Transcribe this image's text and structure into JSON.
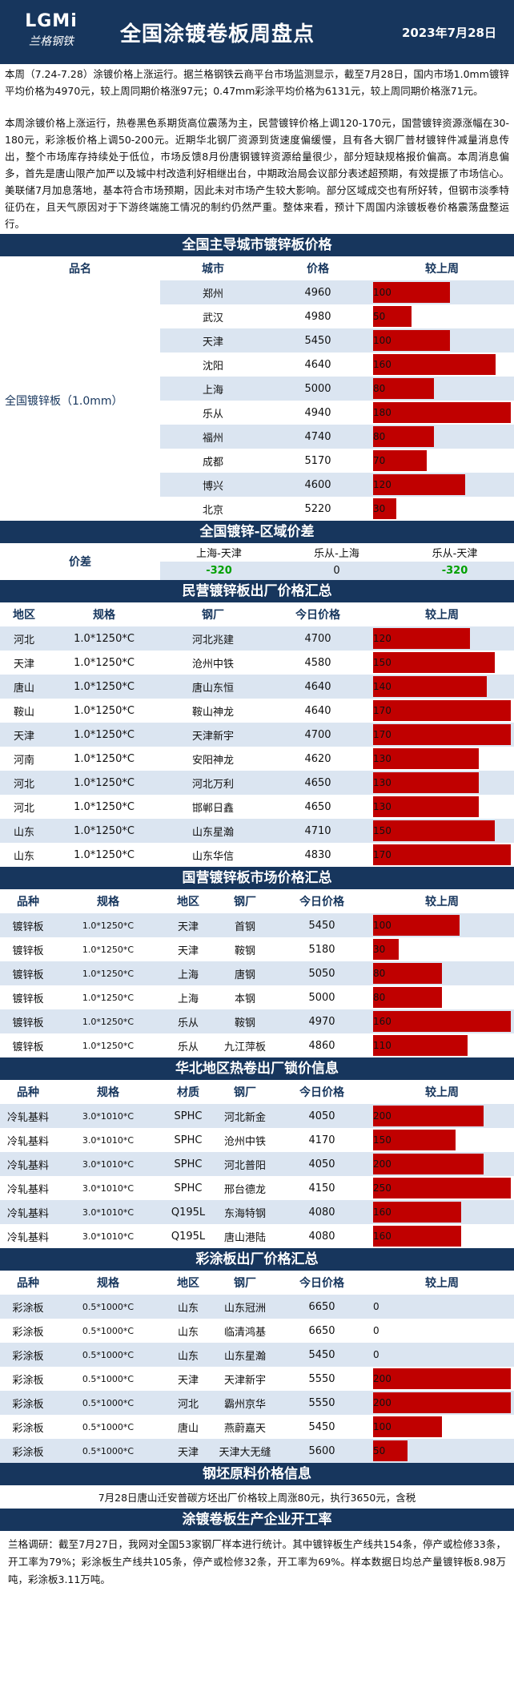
{
  "header": {
    "logo_text": "LGMi",
    "logo_cn": "兰格钢铁",
    "title": "全国涂镀卷板周盘点",
    "date": "2023年7月28日"
  },
  "intro": {
    "p1": "本周（7.24-7.28）涂镀价格上涨运行。据兰格钢铁云商平台市场监测显示，截至7月28日，国内市场1.0mm镀锌平均价格为4970元，较上周同期价格涨97元；0.47mm彩涂平均价格为6131元，较上周同期价格涨71元。",
    "p2": "本周涂镀价格上涨运行，热卷黑色系期货高位震荡为主，民营镀锌价格上调120-170元，国营镀锌资源涨幅在30-180元，彩涂板价格上调50-200元。近期华北钢厂资源到货速度偏缓慢，且有各大钢厂普材镀锌件减量消息传出，整个市场库存持续处于低位，市场反馈8月份唐钢镀锌资源给量很少，部分短缺规格报价偏高。本周消息偏多，首先是唐山限产加严以及城中村改造利好相继出台，中期政治局会议部分表述超预期，有效提振了市场信心。美联储7月加息落地，基本符合市场预期，因此未对市场产生较大影响。部分区域成交也有所好转，但钢市淡季特征仍在，且天气原因对于下游终端施工情况的制约仍然严重。整体来看，预计下周国内涂镀板卷价格震荡盘整运行。"
  },
  "colors": {
    "navy": "#17365d",
    "bar": "#c00000",
    "neg": "#00a000",
    "band": "#dbe5f1"
  },
  "sec1": {
    "title": "全国主导城市镀锌板价格",
    "headers": [
      "品名",
      "城市",
      "价格",
      "较上周"
    ],
    "product": "全国镀锌板（1.0mm）",
    "rows": [
      {
        "city": "郑州",
        "price": "4960",
        "chg": "100"
      },
      {
        "city": "武汉",
        "price": "4980",
        "chg": "50"
      },
      {
        "city": "天津",
        "price": "5450",
        "chg": "100"
      },
      {
        "city": "沈阳",
        "price": "4640",
        "chg": "160"
      },
      {
        "city": "上海",
        "price": "5000",
        "chg": "80"
      },
      {
        "city": "乐从",
        "price": "4940",
        "chg": "180"
      },
      {
        "city": "福州",
        "price": "4740",
        "chg": "80"
      },
      {
        "city": "成都",
        "price": "5170",
        "chg": "70"
      },
      {
        "city": "博兴",
        "price": "4600",
        "chg": "120"
      },
      {
        "city": "北京",
        "price": "5220",
        "chg": "30"
      }
    ]
  },
  "sec2": {
    "title": "全国镀锌-区域价差",
    "label": "价差",
    "cols": [
      "上海-天津",
      "乐从-上海",
      "乐从-天津"
    ],
    "vals": [
      "-320",
      "0",
      "-320"
    ]
  },
  "sec3": {
    "title": "民营镀锌板出厂价格汇总",
    "headers": [
      "地区",
      "规格",
      "钢厂",
      "今日价格",
      "较上周"
    ],
    "rows": [
      {
        "region": "河北",
        "spec": "1.0*1250*C",
        "mill": "河北兆建",
        "price": "4700",
        "chg": "120"
      },
      {
        "region": "天津",
        "spec": "1.0*1250*C",
        "mill": "沧州中铁",
        "price": "4580",
        "chg": "150"
      },
      {
        "region": "唐山",
        "spec": "1.0*1250*C",
        "mill": "唐山东恒",
        "price": "4640",
        "chg": "140"
      },
      {
        "region": "鞍山",
        "spec": "1.0*1250*C",
        "mill": "鞍山神龙",
        "price": "4640",
        "chg": "170"
      },
      {
        "region": "天津",
        "spec": "1.0*1250*C",
        "mill": "天津新宇",
        "price": "4700",
        "chg": "170"
      },
      {
        "region": "河南",
        "spec": "1.0*1250*C",
        "mill": "安阳神龙",
        "price": "4620",
        "chg": "130"
      },
      {
        "region": "河北",
        "spec": "1.0*1250*C",
        "mill": "河北万利",
        "price": "4650",
        "chg": "130"
      },
      {
        "region": "河北",
        "spec": "1.0*1250*C",
        "mill": "邯郸日鑫",
        "price": "4650",
        "chg": "130"
      },
      {
        "region": "山东",
        "spec": "1.0*1250*C",
        "mill": "山东星瀚",
        "price": "4710",
        "chg": "150"
      },
      {
        "region": "山东",
        "spec": "1.0*1250*C",
        "mill": "山东华信",
        "price": "4830",
        "chg": "170"
      }
    ]
  },
  "sec4": {
    "title": "国营镀锌板市场价格汇总",
    "headers": [
      "品种",
      "规格",
      "地区",
      "钢厂",
      "今日价格",
      "较上周"
    ],
    "rows": [
      {
        "kind": "镀锌板",
        "spec": "1.0*1250*C",
        "region": "天津",
        "mill": "首钢",
        "price": "5450",
        "chg": "100"
      },
      {
        "kind": "镀锌板",
        "spec": "1.0*1250*C",
        "region": "天津",
        "mill": "鞍钢",
        "price": "5180",
        "chg": "30"
      },
      {
        "kind": "镀锌板",
        "spec": "1.0*1250*C",
        "region": "上海",
        "mill": "唐钢",
        "price": "5050",
        "chg": "80"
      },
      {
        "kind": "镀锌板",
        "spec": "1.0*1250*C",
        "region": "上海",
        "mill": "本钢",
        "price": "5000",
        "chg": "80"
      },
      {
        "kind": "镀锌板",
        "spec": "1.0*1250*C",
        "region": "乐从",
        "mill": "鞍钢",
        "price": "4970",
        "chg": "160"
      },
      {
        "kind": "镀锌板",
        "spec": "1.0*1250*C",
        "region": "乐从",
        "mill": "九江萍板",
        "price": "4860",
        "chg": "110"
      }
    ]
  },
  "sec5": {
    "title": "华北地区热卷出厂锁价信息",
    "headers": [
      "品种",
      "规格",
      "材质",
      "钢厂",
      "今日价格",
      "较上周"
    ],
    "rows": [
      {
        "kind": "冷轧基料",
        "spec": "3.0*1010*C",
        "mat": "SPHC",
        "mill": "河北新金",
        "price": "4050",
        "chg": "200"
      },
      {
        "kind": "冷轧基料",
        "spec": "3.0*1010*C",
        "mat": "SPHC",
        "mill": "沧州中铁",
        "price": "4170",
        "chg": "150"
      },
      {
        "kind": "冷轧基料",
        "spec": "3.0*1010*C",
        "mat": "SPHC",
        "mill": "河北普阳",
        "price": "4050",
        "chg": "200"
      },
      {
        "kind": "冷轧基料",
        "spec": "3.0*1010*C",
        "mat": "SPHC",
        "mill": "邢台德龙",
        "price": "4150",
        "chg": "250"
      },
      {
        "kind": "冷轧基料",
        "spec": "3.0*1010*C",
        "mat": "Q195L",
        "mill": "东海特钢",
        "price": "4080",
        "chg": "160"
      },
      {
        "kind": "冷轧基料",
        "spec": "3.0*1010*C",
        "mat": "Q195L",
        "mill": "唐山港陆",
        "price": "4080",
        "chg": "160"
      }
    ]
  },
  "sec6": {
    "title": "彩涂板出厂价格汇总",
    "headers": [
      "品种",
      "规格",
      "地区",
      "钢厂",
      "今日价格",
      "较上周"
    ],
    "rows": [
      {
        "kind": "彩涂板",
        "spec": "0.5*1000*C",
        "region": "山东",
        "mill": "山东冠洲",
        "price": "6650",
        "chg": "0"
      },
      {
        "kind": "彩涂板",
        "spec": "0.5*1000*C",
        "region": "山东",
        "mill": "临清鸿基",
        "price": "6650",
        "chg": "0"
      },
      {
        "kind": "彩涂板",
        "spec": "0.5*1000*C",
        "region": "山东",
        "mill": "山东星瀚",
        "price": "5450",
        "chg": "0"
      },
      {
        "kind": "彩涂板",
        "spec": "0.5*1000*C",
        "region": "天津",
        "mill": "天津新宇",
        "price": "5550",
        "chg": "200"
      },
      {
        "kind": "彩涂板",
        "spec": "0.5*1000*C",
        "region": "河北",
        "mill": "霸州京华",
        "price": "5550",
        "chg": "200"
      },
      {
        "kind": "彩涂板",
        "spec": "0.5*1000*C",
        "region": "唐山",
        "mill": "燕蔚嘉天",
        "price": "5450",
        "chg": "100"
      },
      {
        "kind": "彩涂板",
        "spec": "0.5*1000*C",
        "region": "天津",
        "mill": "天津大无缝",
        "price": "5600",
        "chg": "50"
      }
    ]
  },
  "sec7": {
    "title": "钢坯原料价格信息",
    "text": "7月28日唐山迁安普碳方坯出厂价格较上周涨80元，执行3650元，含税"
  },
  "sec8": {
    "title": "涂镀卷板生产企业开工率",
    "text": "兰格调研：截至7月27日，我网对全国53家钢厂样本进行统计。其中镀锌板生产线共154条，停产或检修33条，开工率为79%；彩涂板生产线共105条，停产或检修32条，开工率为69%。样本数据日均总产量镀锌板8.98万吨，彩涂板3.11万吨。"
  }
}
